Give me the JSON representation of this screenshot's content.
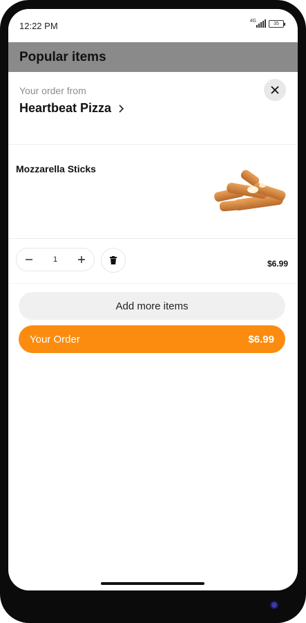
{
  "status_bar": {
    "time": "12:22 PM",
    "network": "4G",
    "battery": "35"
  },
  "header": {
    "title": "Popular items"
  },
  "order": {
    "from_label": "Your order from",
    "restaurant": "Heartbeat Pizza"
  },
  "item": {
    "name": "Mozzarella Sticks",
    "quantity": "1",
    "price": "$6.99"
  },
  "buttons": {
    "add_more": "Add more items",
    "your_order": "Your Order",
    "your_order_total": "$6.99"
  },
  "colors": {
    "accent": "#fb8c0f",
    "header_bg": "#8a8a8a",
    "secondary_button_bg": "#f0f0f0"
  },
  "icons": {
    "close": "close-icon",
    "chevron": "chevron-right-icon",
    "minus": "minus-icon",
    "plus": "plus-icon",
    "delete": "trash-icon"
  }
}
